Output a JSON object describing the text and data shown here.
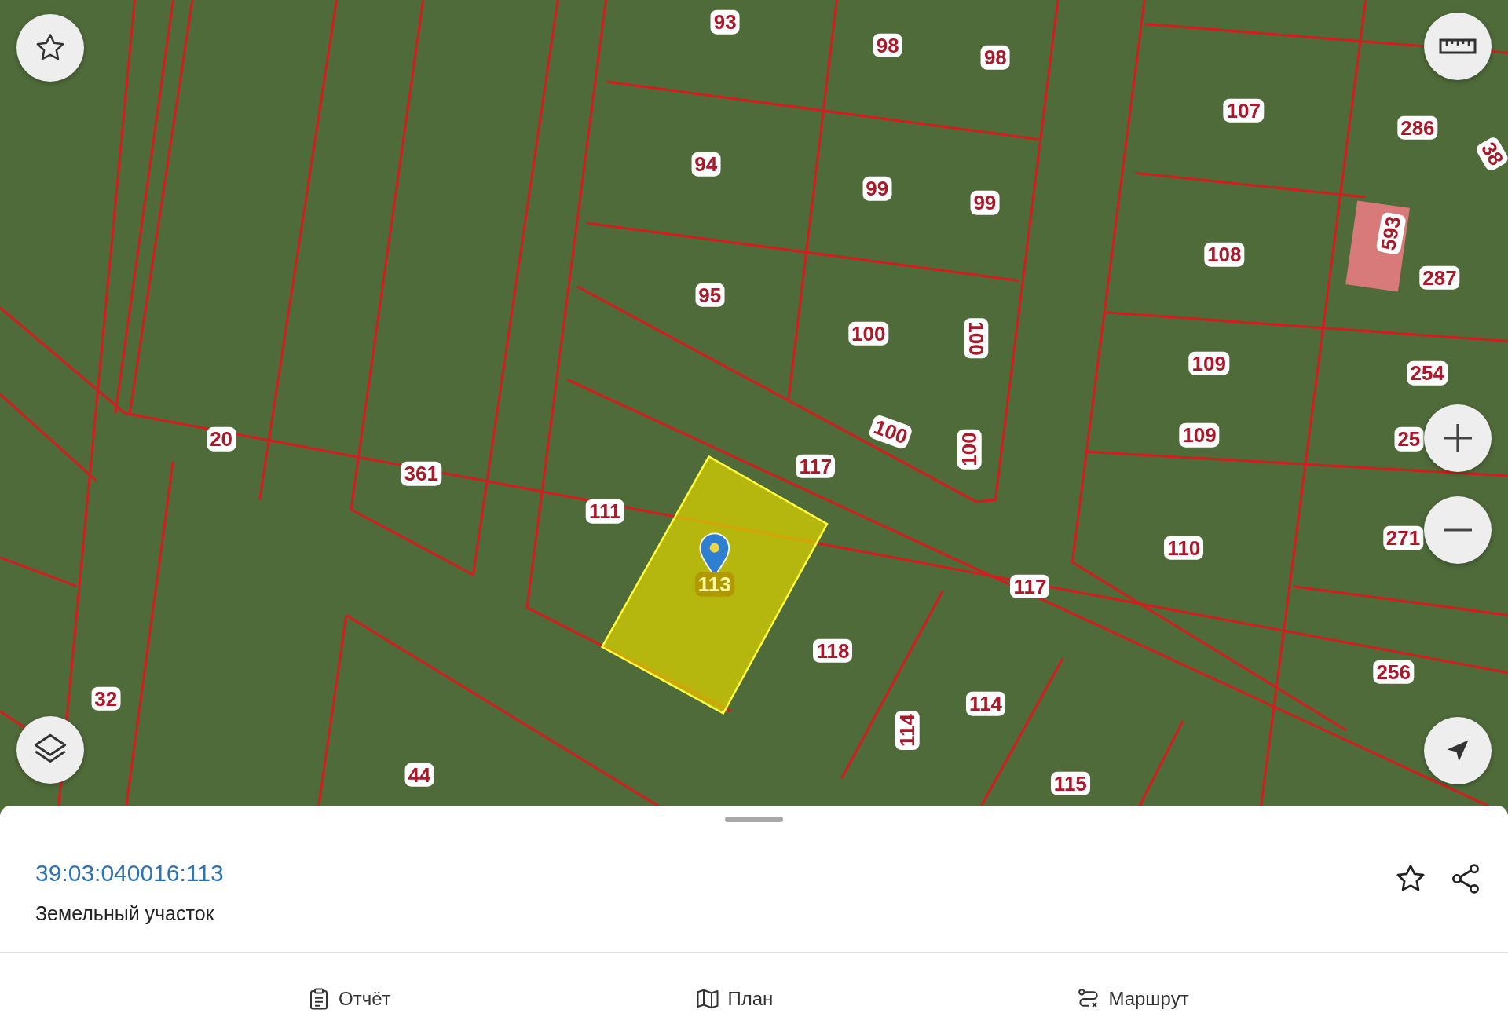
{
  "map": {
    "parcels": [
      {
        "number": "93",
        "selected": false
      },
      {
        "number": "98",
        "selected": false
      },
      {
        "number": "98",
        "selected": false
      },
      {
        "number": "107",
        "selected": false
      },
      {
        "number": "286",
        "selected": false
      },
      {
        "number": "38",
        "selected": false
      },
      {
        "number": "94",
        "selected": false
      },
      {
        "number": "99",
        "selected": false
      },
      {
        "number": "99",
        "selected": false
      },
      {
        "number": "593",
        "selected": false
      },
      {
        "number": "108",
        "selected": false
      },
      {
        "number": "287",
        "selected": false
      },
      {
        "number": "95",
        "selected": false
      },
      {
        "number": "100",
        "selected": false
      },
      {
        "number": "100",
        "selected": false
      },
      {
        "number": "109",
        "selected": false
      },
      {
        "number": "254",
        "selected": false
      },
      {
        "number": "20",
        "selected": false
      },
      {
        "number": "100",
        "selected": false
      },
      {
        "number": "100",
        "selected": false
      },
      {
        "number": "109",
        "selected": false
      },
      {
        "number": "25",
        "selected": false
      },
      {
        "number": "361",
        "selected": false
      },
      {
        "number": "117",
        "selected": false
      },
      {
        "number": "111",
        "selected": false
      },
      {
        "number": "110",
        "selected": false
      },
      {
        "number": "271",
        "selected": false
      },
      {
        "number": "113",
        "selected": true
      },
      {
        "number": "117",
        "selected": false
      },
      {
        "number": "118",
        "selected": false
      },
      {
        "number": "256",
        "selected": false
      },
      {
        "number": "32",
        "selected": false
      },
      {
        "number": "114",
        "selected": false
      },
      {
        "number": "114",
        "selected": false
      },
      {
        "number": "44",
        "selected": false
      },
      {
        "number": "115",
        "selected": false
      }
    ]
  },
  "card": {
    "cadastral_number": "39:03:040016:113",
    "type": "Земельный участок"
  },
  "bottom_bar": [
    {
      "label": "Отчёт",
      "kind": "report"
    },
    {
      "label": "План",
      "kind": "plan"
    },
    {
      "label": "Маршрут",
      "kind": "route"
    }
  ]
}
